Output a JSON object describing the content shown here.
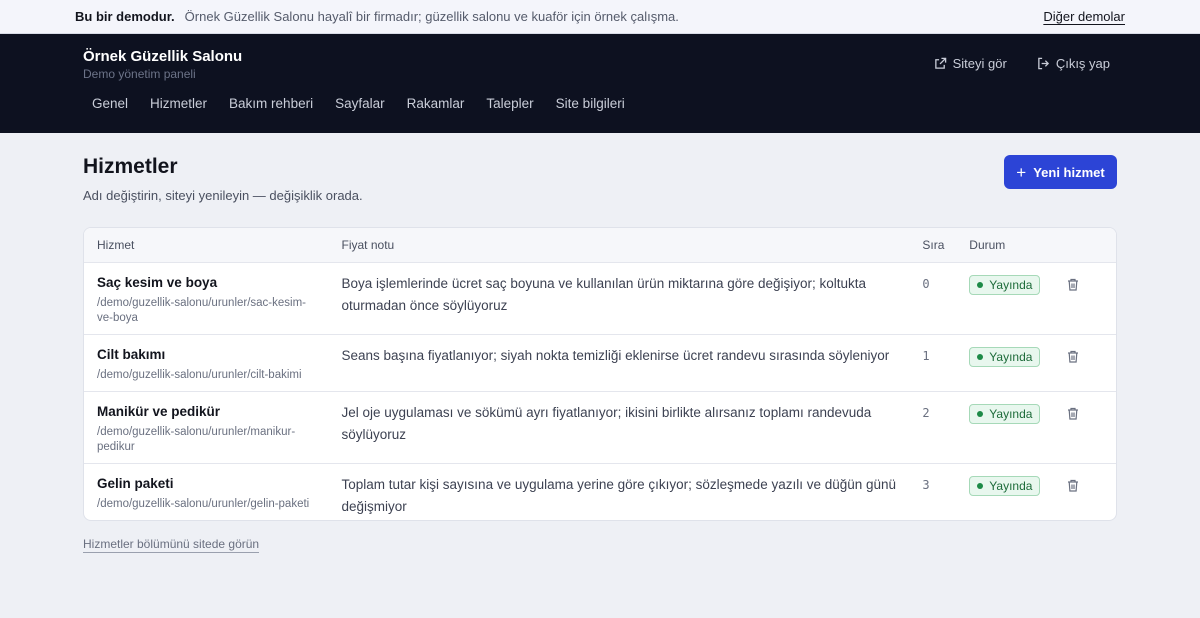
{
  "demo_bar": {
    "strong": "Bu bir demodur.",
    "desc": "Örnek Güzellik Salonu hayalî bir firmadır; güzellik salonu ve kuaför için örnek çalışma.",
    "link": "Diğer demolar"
  },
  "header": {
    "title": "Örnek Güzellik Salonu",
    "subtitle": "Demo yönetim paneli",
    "view_site": "Siteyi gör",
    "logout": "Çıkış yap"
  },
  "nav": [
    "Genel",
    "Hizmetler",
    "Bakım rehberi",
    "Sayfalar",
    "Rakamlar",
    "Talepler",
    "Site bilgileri"
  ],
  "page": {
    "title": "Hizmetler",
    "subtitle": "Adı değiştirin, siteyi yenileyin — değişiklik orada.",
    "new_button": "Yeni hizmet",
    "footer_link": "Hizmetler bölümünü sitede görün"
  },
  "table": {
    "columns": [
      "Hizmet",
      "Fiyat notu",
      "Sıra",
      "Durum"
    ],
    "rows": [
      {
        "name": "Saç kesim ve boya",
        "slug": "/demo/guzellik-salonu/urunler/sac-kesim-ve-boya",
        "note": "Boya işlemlerinde ücret saç boyuna ve kullanılan ürün miktarına göre değişiyor; koltukta oturmadan önce söylüyoruz",
        "order": "0",
        "status": "Yayında"
      },
      {
        "name": "Cilt bakımı",
        "slug": "/demo/guzellik-salonu/urunler/cilt-bakimi",
        "note": "Seans başına fiyatlanıyor; siyah nokta temizliği eklenirse ücret randevu sırasında söyleniyor",
        "order": "1",
        "status": "Yayında"
      },
      {
        "name": "Manikür ve pedikür",
        "slug": "/demo/guzellik-salonu/urunler/manikur-pedikur",
        "note": "Jel oje uygulaması ve sökümü ayrı fiyatlanıyor; ikisini birlikte alırsanız toplamı randevuda söylüyoruz",
        "order": "2",
        "status": "Yayında"
      },
      {
        "name": "Gelin paketi",
        "slug": "/demo/guzellik-salonu/urunler/gelin-paketi",
        "note": "Toplam tutar kişi sayısına ve uygulama yerine göre çıkıyor; sözleşmede yazılı ve düğün günü değişmiyor",
        "order": "3",
        "status": "Yayında"
      }
    ]
  },
  "colors": {
    "accent": "#2c44d6",
    "header_bg": "#0d1120",
    "status_green": "#1d8a47"
  },
  "icons": {
    "view_site": "external-link-icon",
    "logout": "logout-icon",
    "add": "plus-icon",
    "delete": "trash-icon"
  }
}
